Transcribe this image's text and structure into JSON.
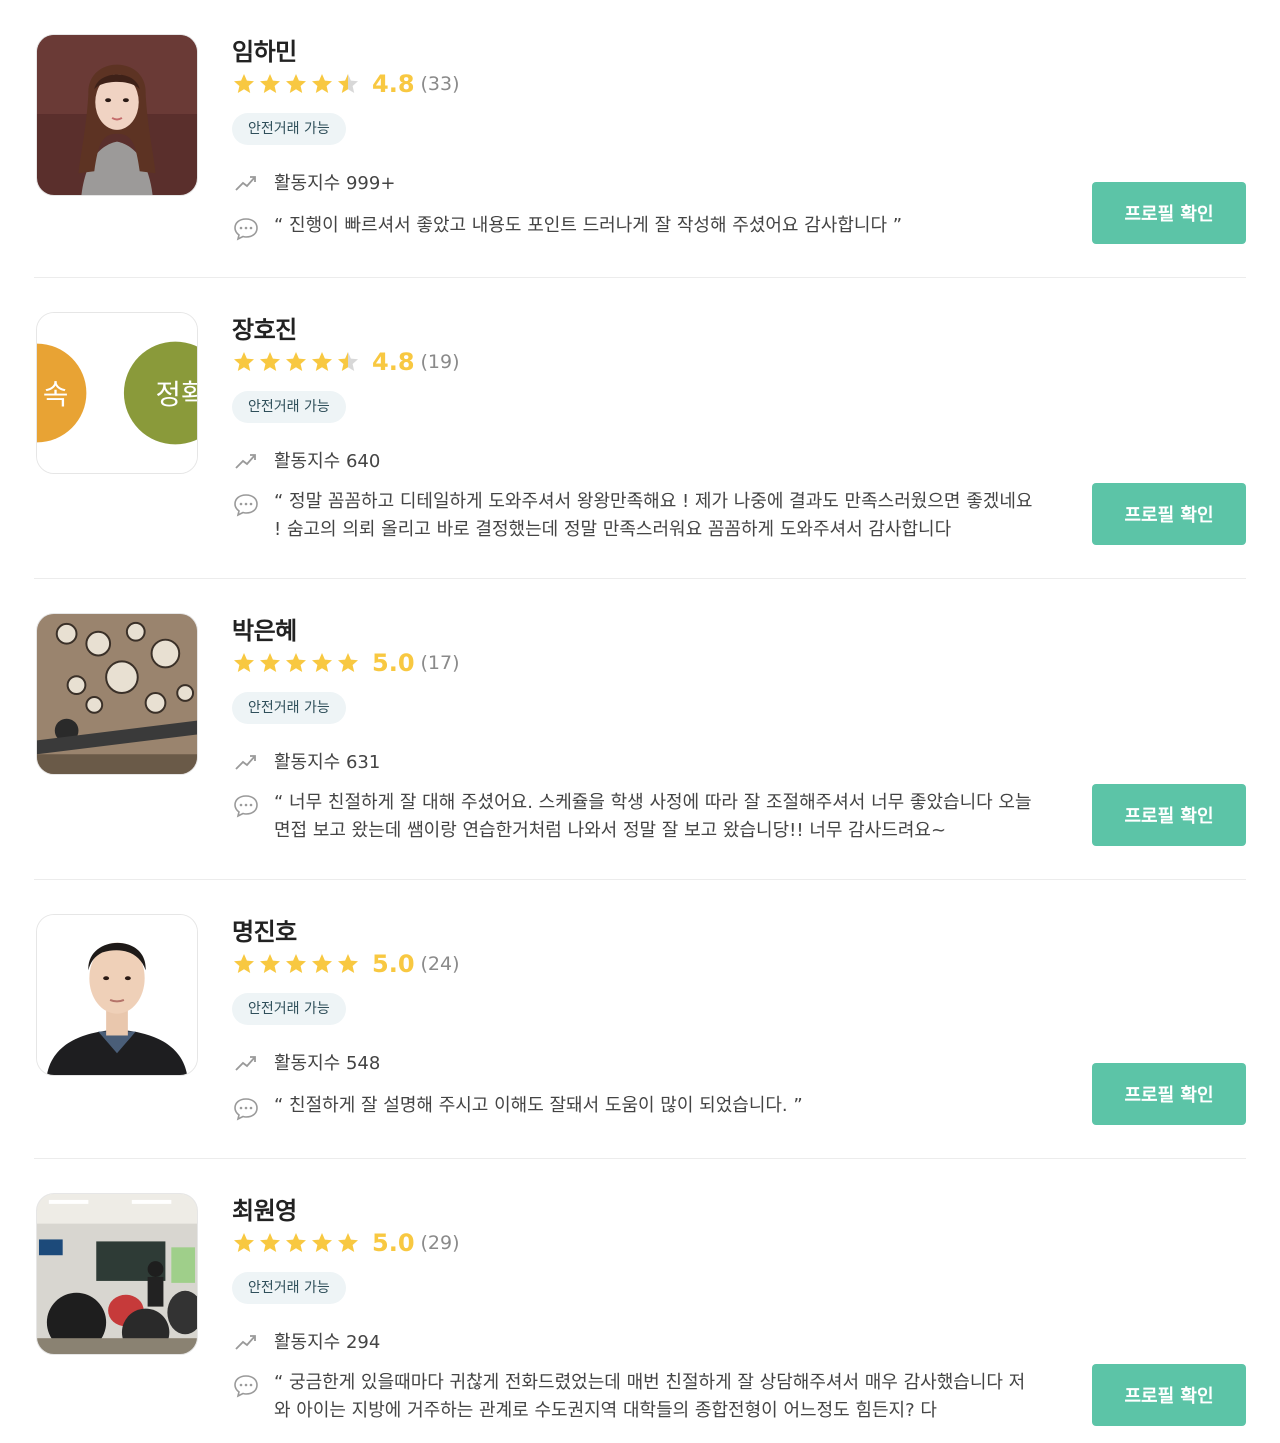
{
  "pros": [
    {
      "name": "임하민",
      "score": "4.8",
      "count": "(33)",
      "badge": "안전거래 가능",
      "activity": "활동지수 999+",
      "review": "“ 진행이 빠르셔서 좋았고 내용도 포인트 드러나게 잘 작성해 주셨어요 감사합니다 ”",
      "button": "프로필 확인",
      "rating_value": 4.5
    },
    {
      "name": "장호진",
      "score": "4.8",
      "count": "(19)",
      "badge": "안전거래 가능",
      "activity": "활동지수 640",
      "review": "“ 정말 꼼꼼하고 디테일하게 도와주셔서 왕왕만족해요 ! 제가 나중에 결과도 만족스러웠으면 좋겠네요 ! 숨고의 의뢰 올리고 바로 결정했는데 정말 만족스러워요 꼼꼼하게 도와주셔서 감사합니다",
      "button": "프로필 확인",
      "avatar_text_left": "속",
      "avatar_text_right": "정확",
      "rating_value": 4.5
    },
    {
      "name": "박은혜",
      "score": "5.0",
      "count": "(17)",
      "badge": "안전거래 가능",
      "activity": "활동지수 631",
      "review": "“ 너무 친절하게 잘 대해 주셨어요. 스케쥴을 학생 사정에 따라 잘 조절해주셔서 너무 좋았습니다 오늘 면접 보고 왔는데 쌤이랑 연습한거처럼 나와서 정말 잘 보고 왔습니당!! 너무 감사드려요~",
      "button": "프로필 확인",
      "rating_value": 5
    },
    {
      "name": "명진호",
      "score": "5.0",
      "count": "(24)",
      "badge": "안전거래 가능",
      "activity": "활동지수 548",
      "review": "“ 친절하게 잘 설명해 주시고 이해도 잘돼서 도움이 많이 되었습니다. ”",
      "button": "프로필 확인",
      "rating_value": 5
    },
    {
      "name": "최원영",
      "score": "5.0",
      "count": "(29)",
      "badge": "안전거래 가능",
      "activity": "활동지수 294",
      "review": "“ 궁금한게 있을때마다 귀찮게 전화드렸었는데 매번 친절하게 잘 상담해주셔서 매우 감사했습니다 저와 아이는 지방에 거주하는 관계로 수도권지역 대학들의 종합전형이 어느정도 힘든지? 다",
      "button": "프로필 확인",
      "rating_value": 5
    }
  ],
  "colors": {
    "accent": "#5cc4a7",
    "star": "#f8c841",
    "star_empty": "#d8d8d8"
  },
  "icons": {
    "activity": "trend-up-icon",
    "review": "speech-bubble-icon",
    "rating": "star-icon"
  }
}
